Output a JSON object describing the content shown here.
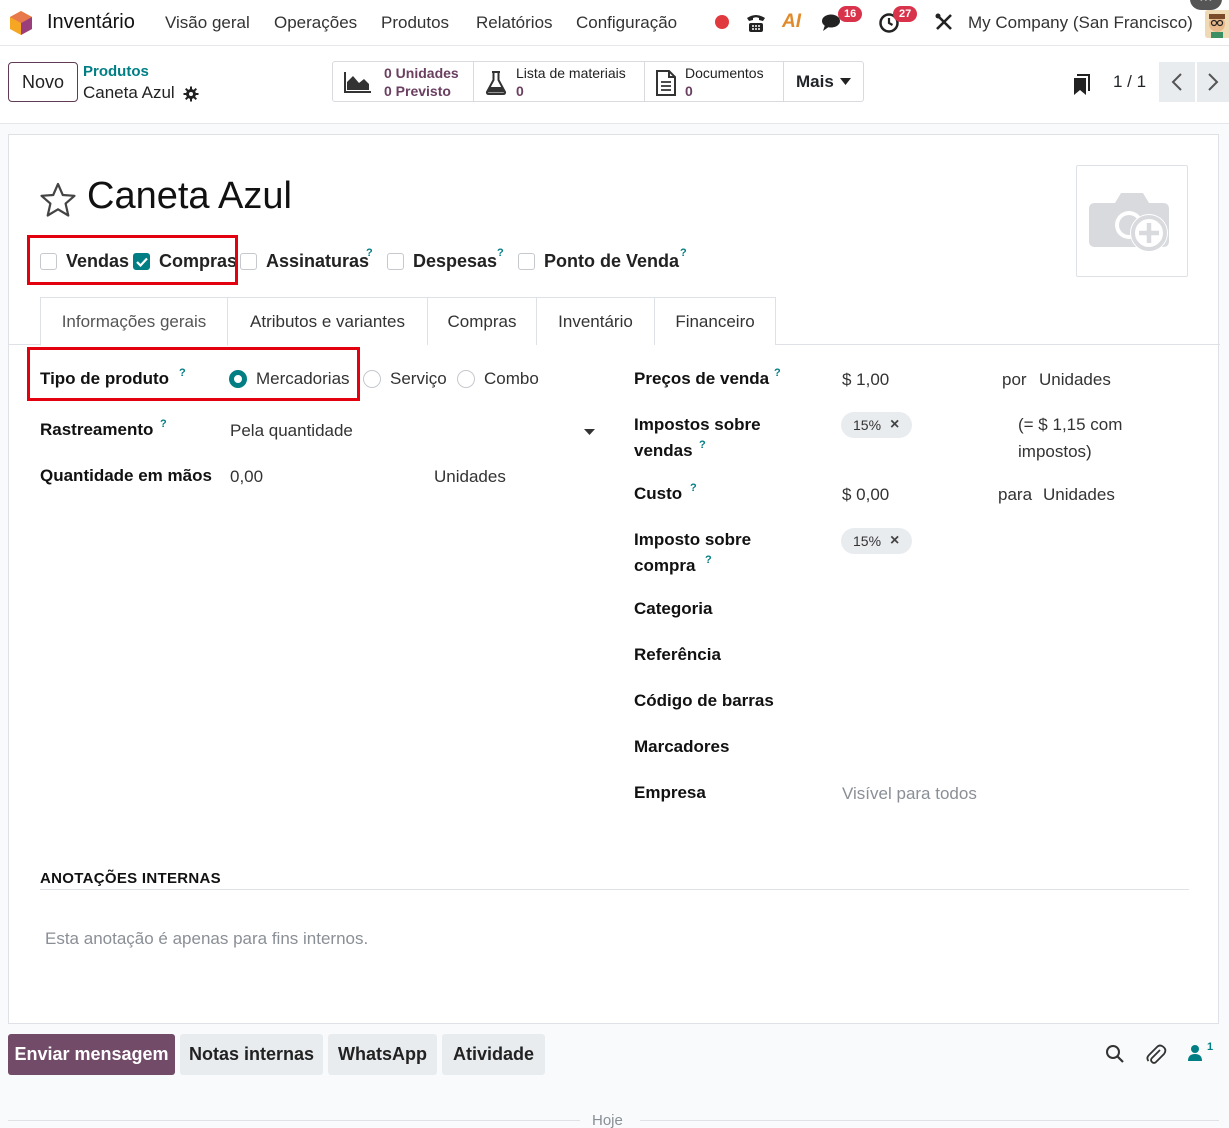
{
  "navbar": {
    "app_name": "Inventário",
    "menus": [
      "Visão geral",
      "Operações",
      "Produtos",
      "Relatórios",
      "Configuração"
    ],
    "messages_badge": "16",
    "activities_badge": "27",
    "ai_label": "AI",
    "company": "My Company (San Francisco)"
  },
  "control": {
    "new_button": "Novo",
    "breadcrumb_parent": "Produtos",
    "breadcrumb_current": "Caneta Azul",
    "stat_forecast_line1": "0 Unidades",
    "stat_forecast_line2": "0 Previsto",
    "stat_bom_label": "Lista de materiais",
    "stat_bom_value": "0",
    "stat_docs_label": "Documentos",
    "stat_docs_value": "0",
    "more_label": "Mais",
    "pager_value": "1 / 1"
  },
  "form": {
    "title": "Caneta Azul",
    "checkboxes": [
      {
        "label": "Vendas",
        "checked": false
      },
      {
        "label": "Compras",
        "checked": true
      },
      {
        "label": "Assinaturas",
        "checked": false
      },
      {
        "label": "Despesas",
        "checked": false
      },
      {
        "label": "Ponto de Venda",
        "checked": false
      }
    ],
    "tabs": [
      "Informações gerais",
      "Atributos e variantes",
      "Compras",
      "Inventário",
      "Financeiro"
    ],
    "active_tab": "Informações gerais",
    "left": {
      "product_type_label": "Tipo de produto",
      "product_type_options": [
        "Mercadorias",
        "Serviço",
        "Combo"
      ],
      "product_type_selected": "Mercadorias",
      "tracking_label": "Rastreamento",
      "tracking_value": "Pela quantidade",
      "qty_label": "Quantidade em mãos",
      "qty_value": "0,00",
      "qty_uom": "Unidades"
    },
    "right": {
      "sale_price_label": "Preços de venda",
      "sale_price_value": "$ 1,00",
      "sale_price_per": "por",
      "sale_price_uom": "Unidades",
      "sale_tax_label_1": "Impostos sobre",
      "sale_tax_label_2": "vendas",
      "sale_tax_tag": "15%",
      "tax_included_1": "(= $ 1,15 com",
      "tax_included_2": "impostos)",
      "cost_label": "Custo",
      "cost_value": "$ 0,00",
      "cost_per": "para",
      "cost_uom": "Unidades",
      "purchase_tax_label_1": "Imposto sobre",
      "purchase_tax_label_2": "compra",
      "purchase_tax_tag": "15%",
      "category_label": "Categoria",
      "reference_label": "Referência",
      "barcode_label": "Código de barras",
      "tags_label": "Marcadores",
      "company_label": "Empresa",
      "company_placeholder": "Visível para todos"
    },
    "notes_heading": "ANOTAÇÕES INTERNAS",
    "notes_placeholder": "Esta anotação é apenas para fins internos."
  },
  "chatter": {
    "send_message": "Enviar mensagem",
    "internal_notes": "Notas internas",
    "whatsapp": "WhatsApp",
    "activity": "Atividade",
    "followers_count": "1",
    "today": "Hoje"
  },
  "colors": {
    "brand": "#714b67",
    "teal": "#017e84",
    "highlight": "#e3000f",
    "badge": "#d9324b"
  }
}
